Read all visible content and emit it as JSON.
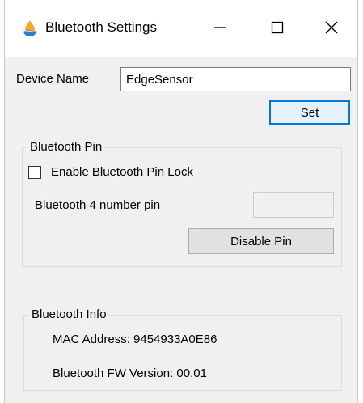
{
  "window": {
    "title": "Bluetooth Settings",
    "minimize_icon": "minimize-icon",
    "maximize_icon": "maximize-icon",
    "close_icon": "close-icon",
    "app_icon": "flame-drop-icon"
  },
  "device": {
    "name_label": "Device Name",
    "name_value": "EdgeSensor",
    "set_button": "Set"
  },
  "pin_group": {
    "title": "Bluetooth Pin",
    "enable_label": "Enable Bluetooth Pin Lock",
    "enable_checked": false,
    "pin_label": "Bluetooth 4 number pin",
    "pin_value": "",
    "disable_button": "Disable Pin"
  },
  "info_group": {
    "title": "Bluetooth Info",
    "mac_label": "MAC Address: 9454933A0E86",
    "fw_label": "Bluetooth FW Version: 00.01"
  },
  "colors": {
    "accent": "#0078d7",
    "window_bg": "#f0f0f0",
    "icon_orange": "#f5a623",
    "icon_blue": "#2a7fd4"
  }
}
